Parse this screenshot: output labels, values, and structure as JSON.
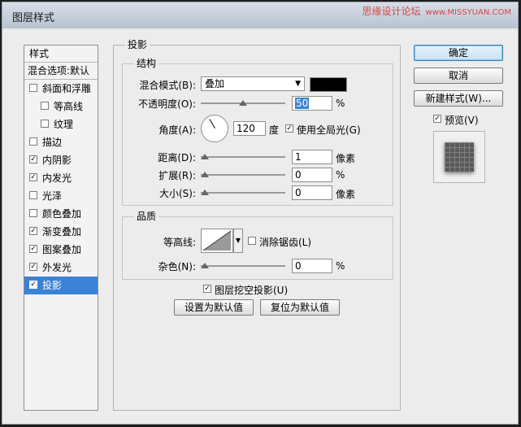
{
  "window": {
    "title": "图层样式",
    "watermark": "思缘设计论坛",
    "watermark_site": "www.MISSYUAN.COM"
  },
  "styles": {
    "header": "样式",
    "blend": "混合选项:默认",
    "items": [
      {
        "label": "斜面和浮雕",
        "checked": false
      },
      {
        "label": "等高线",
        "checked": false
      },
      {
        "label": "纹理",
        "checked": false
      },
      {
        "label": "描边",
        "checked": false
      },
      {
        "label": "内阴影",
        "checked": true
      },
      {
        "label": "内发光",
        "checked": true
      },
      {
        "label": "光泽",
        "checked": false
      },
      {
        "label": "颜色叠加",
        "checked": false
      },
      {
        "label": "渐变叠加",
        "checked": true
      },
      {
        "label": "图案叠加",
        "checked": true
      },
      {
        "label": "外发光",
        "checked": true
      },
      {
        "label": "投影",
        "checked": true,
        "selected": true
      }
    ]
  },
  "shadow": {
    "legend": "投影",
    "structure": {
      "legend": "结构",
      "blend_mode_label": "混合模式(B):",
      "blend_mode": "叠加",
      "blend_color": "#000000",
      "opacity_label": "不透明度(O):",
      "opacity": "50",
      "opacity_unit": "%",
      "angle_label": "角度(A):",
      "angle": "120",
      "angle_unit": "度",
      "global_light_label": "使用全局光(G)",
      "global_light": true,
      "distance_label": "距离(D):",
      "distance": "1",
      "distance_unit": "像素",
      "spread_label": "扩展(R):",
      "spread": "0",
      "spread_unit": "%",
      "size_label": "大小(S):",
      "size": "0",
      "size_unit": "像素"
    },
    "quality": {
      "legend": "品质",
      "contour_label": "等高线:",
      "antialias_label": "消除锯齿(L)",
      "antialias": false,
      "noise_label": "杂色(N):",
      "noise": "0",
      "noise_unit": "%"
    },
    "knockout_label": "图层挖空投影(U)",
    "knockout": true,
    "make_default": "设置为默认值",
    "reset_default": "复位为默认值"
  },
  "buttons": {
    "ok": "确定",
    "cancel": "取消",
    "new_style": "新建样式(W)...",
    "preview_label": "预览(V)",
    "preview": true
  }
}
